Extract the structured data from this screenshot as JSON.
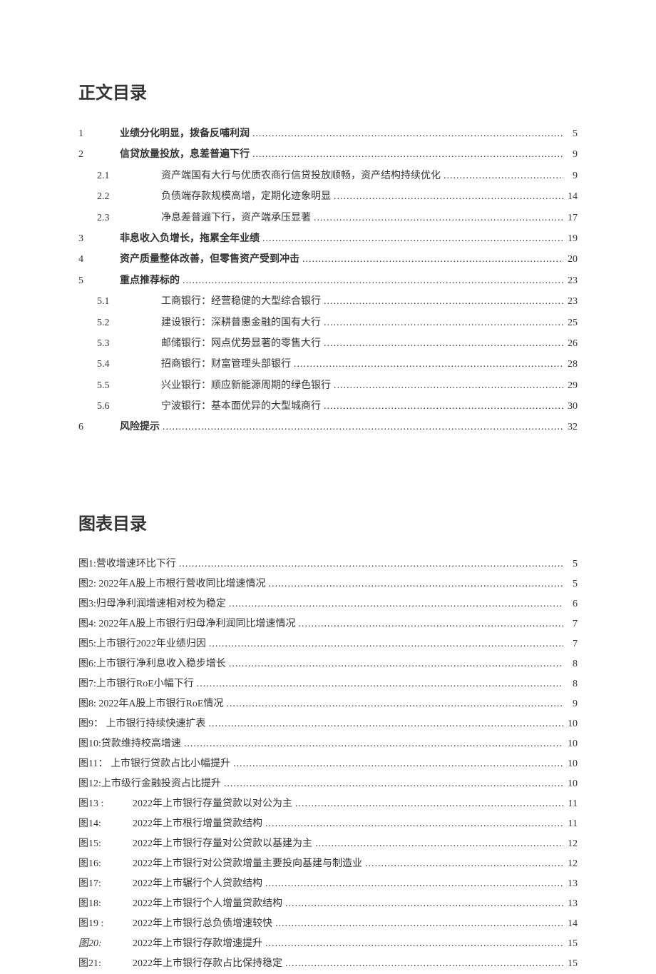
{
  "titles": {
    "contents": "正文目录",
    "figures": "图表目录"
  },
  "dots": "........................................................................................................................................................",
  "toc": [
    {
      "num": "1",
      "title": "业绩分化明显，拨备反哺利润",
      "page": "5",
      "bold": true
    },
    {
      "num": "2",
      "title": "信贷放量投放，息差普遍下行",
      "page": "9",
      "bold": true
    },
    {
      "num": "2.1",
      "sub": true,
      "title": "资产端国有大行与优质农商行信贷投放顺畅，资产结构持续优化",
      "page": "9"
    },
    {
      "num": "2.2",
      "sub": true,
      "title": "负债端存款规模高增，定期化迹象明显",
      "page": "14"
    },
    {
      "num": "2.3",
      "sub": true,
      "title": "净息差普遍下行，资产端承压显著",
      "page": "17"
    },
    {
      "num": "3",
      "title": "非息收入负增长，拖累全年业绩",
      "page": "19",
      "bold": true
    },
    {
      "num": "4",
      "title": "资产质量整体改善，但零售资产受到冲击",
      "page": "20",
      "bold": true
    },
    {
      "num": "5",
      "title": "重点推荐标的",
      "page": "23",
      "bold": true
    },
    {
      "num": "5.1",
      "sub": true,
      "title": "工商银行：经营稳健的大型综合银行",
      "page": "23"
    },
    {
      "num": "5.2",
      "sub": true,
      "title": "建设银行：深耕普惠金融的国有大行",
      "page": "25"
    },
    {
      "num": "5.3",
      "sub": true,
      "title": "邮储银行：网点优势显著的零售大行",
      "page": "26"
    },
    {
      "num": "5.4",
      "sub": true,
      "title": "招商银行：财富管理头部银行",
      "page": "28"
    },
    {
      "num": "5.5",
      "sub": true,
      "title": "兴业银行：顺应新能源周期的绿色银行",
      "page": "29"
    },
    {
      "num": "5.6",
      "sub": true,
      "title": "宁波银行：基本面优异的大型城商行",
      "page": "30"
    },
    {
      "num": "6",
      "title": "风险提示",
      "page": "32",
      "bold": true
    }
  ],
  "figures": [
    {
      "label": "图1:营收增速环比下行",
      "page": "5"
    },
    {
      "label": "图2: 2022年A股上市根行营收同比增速情况",
      "page": "5"
    },
    {
      "label": "图3:归母净利润增速相对校为稳定",
      "page": "6"
    },
    {
      "label": "图4: 2022年A股上市银行归母净利润同比增速情况",
      "page": "7"
    },
    {
      "label": "图5:上市银行2022年业绩归因",
      "page": "7"
    },
    {
      "label": "图6:上市银行净利息收入稳步增长",
      "page": "8"
    },
    {
      "label": "图7:上市银行RoE小幅下行",
      "page": "8"
    },
    {
      "label": "图8: 2022年A股上市银行RoE情况",
      "page": "9"
    },
    {
      "label": "图9：  上市银行持续快速扩表",
      "page": "10"
    },
    {
      "label": "图10:贷款维持校高增速",
      "page": "10"
    },
    {
      "label": "图11：  上市银行贷款占比小幅提升",
      "page": "10"
    },
    {
      "label": "图12:上市级行金融投资占比提升",
      "page": "10"
    },
    {
      "num": "图13 :",
      "title": "2022年上市银行存量贷款以对公为主",
      "page": "11"
    },
    {
      "num": "图14:",
      "title": "2022年上市根行增量贷款结构",
      "page": "11"
    },
    {
      "num": "图15:",
      "title": "2022年上市银行存量对公贷款以基建为主",
      "page": "12"
    },
    {
      "num": "图16:",
      "title": "2022年上市银行对公贷款增量主要投向基建与制造业",
      "page": "12"
    },
    {
      "num": "图17:",
      "title": "2022年上市辗行个人贷款结构",
      "page": "13"
    },
    {
      "num": "图18:",
      "title": "2022年上市银行个人增量贷款结构",
      "page": "13"
    },
    {
      "num": "图19 :",
      "title": "2022年上市银行总负债增速较快",
      "page": "14"
    },
    {
      "num": "图20:",
      "title": "2022年上市银行存款增速提升",
      "page": "15",
      "italicNum": true
    },
    {
      "num": "图21:",
      "title": "2022年上市银行存款占比保持稳定",
      "page": "15"
    }
  ]
}
